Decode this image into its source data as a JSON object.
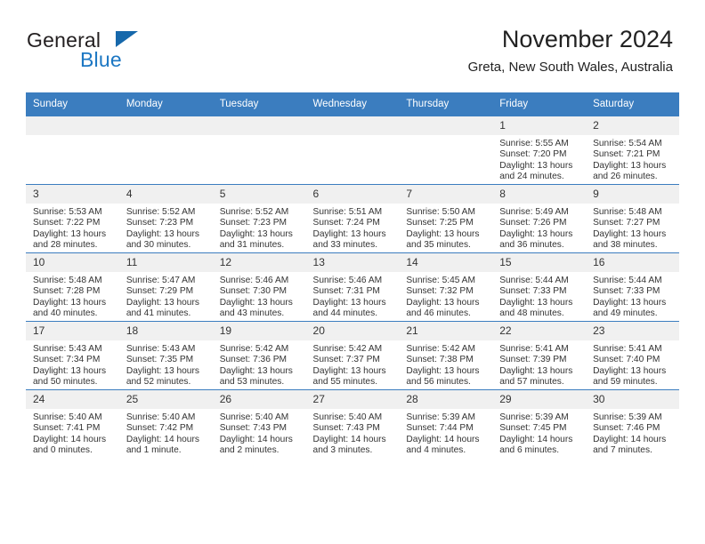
{
  "brand": {
    "name_top": "General",
    "name_bottom": "Blue",
    "accent_color": "#1c77c3",
    "triangle_color": "#1668ab"
  },
  "header": {
    "title": "November 2024",
    "subtitle": "Greta, New South Wales, Australia"
  },
  "theme": {
    "header_row_bg": "#3b7dbf",
    "daynum_bg": "#f0f0f0",
    "grid_line": "#3b7dbf",
    "text": "#333333"
  },
  "calendar": {
    "weekday_headers": [
      "Sunday",
      "Monday",
      "Tuesday",
      "Wednesday",
      "Thursday",
      "Friday",
      "Saturday"
    ],
    "labels": {
      "sunrise": "Sunrise:",
      "sunset": "Sunset:",
      "daylight": "Daylight:"
    },
    "weeks": [
      [
        {
          "day": "",
          "blank": true,
          "sunrise": "",
          "sunset": "",
          "daylight_line1": "",
          "daylight_line2": ""
        },
        {
          "day": "",
          "blank": true,
          "sunrise": "",
          "sunset": "",
          "daylight_line1": "",
          "daylight_line2": ""
        },
        {
          "day": "",
          "blank": true,
          "sunrise": "",
          "sunset": "",
          "daylight_line1": "",
          "daylight_line2": ""
        },
        {
          "day": "",
          "blank": true,
          "sunrise": "",
          "sunset": "",
          "daylight_line1": "",
          "daylight_line2": ""
        },
        {
          "day": "",
          "blank": true,
          "sunrise": "",
          "sunset": "",
          "daylight_line1": "",
          "daylight_line2": ""
        },
        {
          "day": "1",
          "blank": false,
          "sunrise": "Sunrise: 5:55 AM",
          "sunset": "Sunset: 7:20 PM",
          "daylight_line1": "Daylight: 13 hours",
          "daylight_line2": "and 24 minutes."
        },
        {
          "day": "2",
          "blank": false,
          "sunrise": "Sunrise: 5:54 AM",
          "sunset": "Sunset: 7:21 PM",
          "daylight_line1": "Daylight: 13 hours",
          "daylight_line2": "and 26 minutes."
        }
      ],
      [
        {
          "day": "3",
          "blank": false,
          "sunrise": "Sunrise: 5:53 AM",
          "sunset": "Sunset: 7:22 PM",
          "daylight_line1": "Daylight: 13 hours",
          "daylight_line2": "and 28 minutes."
        },
        {
          "day": "4",
          "blank": false,
          "sunrise": "Sunrise: 5:52 AM",
          "sunset": "Sunset: 7:23 PM",
          "daylight_line1": "Daylight: 13 hours",
          "daylight_line2": "and 30 minutes."
        },
        {
          "day": "5",
          "blank": false,
          "sunrise": "Sunrise: 5:52 AM",
          "sunset": "Sunset: 7:23 PM",
          "daylight_line1": "Daylight: 13 hours",
          "daylight_line2": "and 31 minutes."
        },
        {
          "day": "6",
          "blank": false,
          "sunrise": "Sunrise: 5:51 AM",
          "sunset": "Sunset: 7:24 PM",
          "daylight_line1": "Daylight: 13 hours",
          "daylight_line2": "and 33 minutes."
        },
        {
          "day": "7",
          "blank": false,
          "sunrise": "Sunrise: 5:50 AM",
          "sunset": "Sunset: 7:25 PM",
          "daylight_line1": "Daylight: 13 hours",
          "daylight_line2": "and 35 minutes."
        },
        {
          "day": "8",
          "blank": false,
          "sunrise": "Sunrise: 5:49 AM",
          "sunset": "Sunset: 7:26 PM",
          "daylight_line1": "Daylight: 13 hours",
          "daylight_line2": "and 36 minutes."
        },
        {
          "day": "9",
          "blank": false,
          "sunrise": "Sunrise: 5:48 AM",
          "sunset": "Sunset: 7:27 PM",
          "daylight_line1": "Daylight: 13 hours",
          "daylight_line2": "and 38 minutes."
        }
      ],
      [
        {
          "day": "10",
          "blank": false,
          "sunrise": "Sunrise: 5:48 AM",
          "sunset": "Sunset: 7:28 PM",
          "daylight_line1": "Daylight: 13 hours",
          "daylight_line2": "and 40 minutes."
        },
        {
          "day": "11",
          "blank": false,
          "sunrise": "Sunrise: 5:47 AM",
          "sunset": "Sunset: 7:29 PM",
          "daylight_line1": "Daylight: 13 hours",
          "daylight_line2": "and 41 minutes."
        },
        {
          "day": "12",
          "blank": false,
          "sunrise": "Sunrise: 5:46 AM",
          "sunset": "Sunset: 7:30 PM",
          "daylight_line1": "Daylight: 13 hours",
          "daylight_line2": "and 43 minutes."
        },
        {
          "day": "13",
          "blank": false,
          "sunrise": "Sunrise: 5:46 AM",
          "sunset": "Sunset: 7:31 PM",
          "daylight_line1": "Daylight: 13 hours",
          "daylight_line2": "and 44 minutes."
        },
        {
          "day": "14",
          "blank": false,
          "sunrise": "Sunrise: 5:45 AM",
          "sunset": "Sunset: 7:32 PM",
          "daylight_line1": "Daylight: 13 hours",
          "daylight_line2": "and 46 minutes."
        },
        {
          "day": "15",
          "blank": false,
          "sunrise": "Sunrise: 5:44 AM",
          "sunset": "Sunset: 7:33 PM",
          "daylight_line1": "Daylight: 13 hours",
          "daylight_line2": "and 48 minutes."
        },
        {
          "day": "16",
          "blank": false,
          "sunrise": "Sunrise: 5:44 AM",
          "sunset": "Sunset: 7:33 PM",
          "daylight_line1": "Daylight: 13 hours",
          "daylight_line2": "and 49 minutes."
        }
      ],
      [
        {
          "day": "17",
          "blank": false,
          "sunrise": "Sunrise: 5:43 AM",
          "sunset": "Sunset: 7:34 PM",
          "daylight_line1": "Daylight: 13 hours",
          "daylight_line2": "and 50 minutes."
        },
        {
          "day": "18",
          "blank": false,
          "sunrise": "Sunrise: 5:43 AM",
          "sunset": "Sunset: 7:35 PM",
          "daylight_line1": "Daylight: 13 hours",
          "daylight_line2": "and 52 minutes."
        },
        {
          "day": "19",
          "blank": false,
          "sunrise": "Sunrise: 5:42 AM",
          "sunset": "Sunset: 7:36 PM",
          "daylight_line1": "Daylight: 13 hours",
          "daylight_line2": "and 53 minutes."
        },
        {
          "day": "20",
          "blank": false,
          "sunrise": "Sunrise: 5:42 AM",
          "sunset": "Sunset: 7:37 PM",
          "daylight_line1": "Daylight: 13 hours",
          "daylight_line2": "and 55 minutes."
        },
        {
          "day": "21",
          "blank": false,
          "sunrise": "Sunrise: 5:42 AM",
          "sunset": "Sunset: 7:38 PM",
          "daylight_line1": "Daylight: 13 hours",
          "daylight_line2": "and 56 minutes."
        },
        {
          "day": "22",
          "blank": false,
          "sunrise": "Sunrise: 5:41 AM",
          "sunset": "Sunset: 7:39 PM",
          "daylight_line1": "Daylight: 13 hours",
          "daylight_line2": "and 57 minutes."
        },
        {
          "day": "23",
          "blank": false,
          "sunrise": "Sunrise: 5:41 AM",
          "sunset": "Sunset: 7:40 PM",
          "daylight_line1": "Daylight: 13 hours",
          "daylight_line2": "and 59 minutes."
        }
      ],
      [
        {
          "day": "24",
          "blank": false,
          "sunrise": "Sunrise: 5:40 AM",
          "sunset": "Sunset: 7:41 PM",
          "daylight_line1": "Daylight: 14 hours",
          "daylight_line2": "and 0 minutes."
        },
        {
          "day": "25",
          "blank": false,
          "sunrise": "Sunrise: 5:40 AM",
          "sunset": "Sunset: 7:42 PM",
          "daylight_line1": "Daylight: 14 hours",
          "daylight_line2": "and 1 minute."
        },
        {
          "day": "26",
          "blank": false,
          "sunrise": "Sunrise: 5:40 AM",
          "sunset": "Sunset: 7:43 PM",
          "daylight_line1": "Daylight: 14 hours",
          "daylight_line2": "and 2 minutes."
        },
        {
          "day": "27",
          "blank": false,
          "sunrise": "Sunrise: 5:40 AM",
          "sunset": "Sunset: 7:43 PM",
          "daylight_line1": "Daylight: 14 hours",
          "daylight_line2": "and 3 minutes."
        },
        {
          "day": "28",
          "blank": false,
          "sunrise": "Sunrise: 5:39 AM",
          "sunset": "Sunset: 7:44 PM",
          "daylight_line1": "Daylight: 14 hours",
          "daylight_line2": "and 4 minutes."
        },
        {
          "day": "29",
          "blank": false,
          "sunrise": "Sunrise: 5:39 AM",
          "sunset": "Sunset: 7:45 PM",
          "daylight_line1": "Daylight: 14 hours",
          "daylight_line2": "and 6 minutes."
        },
        {
          "day": "30",
          "blank": false,
          "sunrise": "Sunrise: 5:39 AM",
          "sunset": "Sunset: 7:46 PM",
          "daylight_line1": "Daylight: 14 hours",
          "daylight_line2": "and 7 minutes."
        }
      ]
    ]
  }
}
